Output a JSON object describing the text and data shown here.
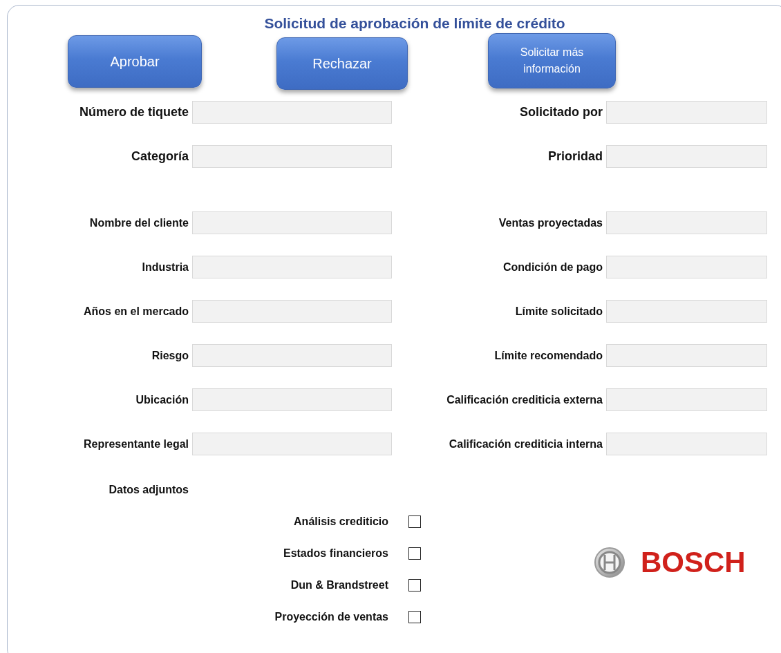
{
  "title": "Solicitud de aprobación de límite de crédito",
  "buttons": [
    "Aprobar",
    "Rechazar",
    "Solicitar más información"
  ],
  "header_rows": [
    {
      "left": "Número de tiquete",
      "right": "Solicitado por"
    },
    {
      "left": "Categoría",
      "right": "Prioridad"
    }
  ],
  "detail_rows": [
    {
      "left": "Nombre del cliente",
      "right": "Ventas proyectadas"
    },
    {
      "left": "Industria",
      "right": "Condición de pago"
    },
    {
      "left": "Años en el mercado",
      "right": "Límite solicitado"
    },
    {
      "left": "Riesgo",
      "right": "Límite recomendado"
    },
    {
      "left": "Ubicación",
      "right": "Calificación crediticia externa"
    },
    {
      "left": "Representante legal",
      "right": "Calificación crediticia interna"
    }
  ],
  "attachments": {
    "title": "Datos adjuntos",
    "items": [
      {
        "label": "Análisis crediticio",
        "checked": false
      },
      {
        "label": "Estados financieros",
        "checked": false
      },
      {
        "label": "Dun & Brandstreet",
        "checked": false
      },
      {
        "label": "Proyección de ventas",
        "checked": false
      }
    ]
  },
  "logo": {
    "brand": "BOSCH"
  }
}
